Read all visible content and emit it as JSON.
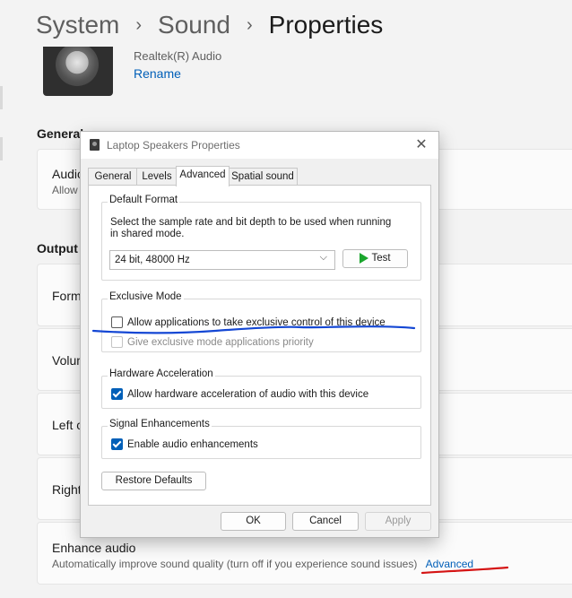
{
  "breadcrumb": {
    "item1": "System",
    "item2": "Sound",
    "current": "Properties",
    "sep": "›"
  },
  "device": {
    "name": "Realtek(R) Audio",
    "rename": "Rename"
  },
  "sections": {
    "general": "General",
    "general_card": {
      "label": "Audio",
      "sub": "Allow"
    },
    "output": "Output",
    "rows": [
      "Form",
      "Volum",
      "Left c",
      "Right"
    ]
  },
  "enhance": {
    "title": "Enhance audio",
    "sub": "Automatically improve sound quality (turn off if you experience sound issues)",
    "advanced_link": "Advanced"
  },
  "dialog": {
    "title": "Laptop Speakers Properties",
    "close_glyph": "✕",
    "tabs": [
      "General",
      "Levels",
      "Advanced",
      "Spatial sound"
    ],
    "active_tab": "Advanced",
    "default_format": {
      "title": "Default Format",
      "desc_line1": "Select the sample rate and bit depth to be used when running",
      "desc_line2": "in shared mode.",
      "selected": "24 bit, 48000 Hz",
      "test_button": "Test"
    },
    "exclusive_mode": {
      "title": "Exclusive Mode",
      "allow_exclusive": {
        "label": "Allow applications to take exclusive control of this device",
        "checked": false
      },
      "priority": {
        "label": "Give exclusive mode applications priority",
        "checked": false,
        "disabled": true
      }
    },
    "hardware_acceleration": {
      "title": "Hardware Acceleration",
      "allow_hw": {
        "label": "Allow hardware acceleration of audio with this device",
        "checked": true
      }
    },
    "signal_enhancements": {
      "title": "Signal Enhancements",
      "enable": {
        "label": "Enable audio enhancements",
        "checked": true
      }
    },
    "restore_defaults": "Restore Defaults",
    "ok": "OK",
    "cancel": "Cancel",
    "apply": "Apply"
  },
  "colors": {
    "annotation": "#1447d4",
    "annotation_red": "#d51414",
    "accent": "#005fb8"
  }
}
